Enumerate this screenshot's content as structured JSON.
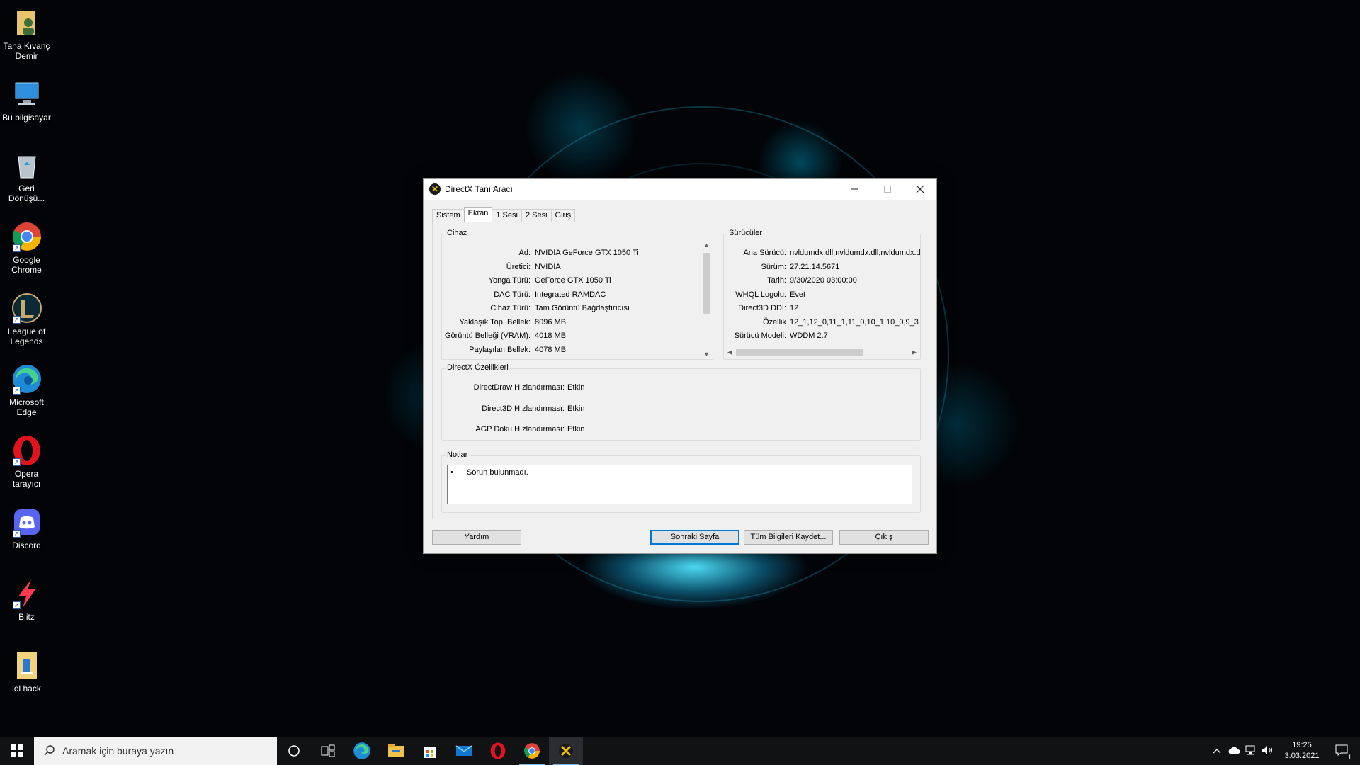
{
  "desktop": {
    "icons": [
      {
        "label": "Taha Kıvanç Demir",
        "icon": "user-folder-icon"
      },
      {
        "label": "Bu bilgisayar",
        "icon": "this-pc-icon"
      },
      {
        "label": "Geri Dönüşü...",
        "icon": "recycle-bin-icon"
      },
      {
        "label": "Google Chrome",
        "icon": "chrome-icon"
      },
      {
        "label": "League of Legends",
        "icon": "league-of-legends-icon"
      },
      {
        "label": "Microsoft Edge",
        "icon": "edge-icon"
      },
      {
        "label": "Opera tarayıcı",
        "icon": "opera-icon"
      },
      {
        "label": "Discord",
        "icon": "discord-icon"
      },
      {
        "label": "Blitz",
        "icon": "blitz-icon"
      },
      {
        "label": "lol hack",
        "icon": "file-icon"
      }
    ]
  },
  "dialog": {
    "title": "DirectX Tanı Aracı",
    "tabs": [
      {
        "label": "Sistem"
      },
      {
        "label": "Ekran",
        "active": true
      },
      {
        "label": "1 Sesi"
      },
      {
        "label": "2 Sesi"
      },
      {
        "label": "Giriş"
      }
    ],
    "device": {
      "label": "Cihaz",
      "rows": [
        {
          "k": "Ad:",
          "v": "NVIDIA GeForce GTX 1050 Ti"
        },
        {
          "k": "Üretici:",
          "v": "NVIDIA"
        },
        {
          "k": "Yonga Türü:",
          "v": "GeForce GTX 1050 Ti"
        },
        {
          "k": "DAC Türü:",
          "v": "Integrated RAMDAC"
        },
        {
          "k": "Cihaz Türü:",
          "v": "Tam Görüntü Bağdaştırıcısı"
        },
        {
          "k": "Yaklaşık Top. Bellek:",
          "v": "8096 MB"
        },
        {
          "k": "Görüntü Belleği (VRAM):",
          "v": "4018 MB"
        },
        {
          "k": "Paylaşılan Bellek:",
          "v": "4078 MB"
        }
      ]
    },
    "drivers": {
      "label": "Sürücüler",
      "rows": [
        {
          "k": "Ana Sürücü:",
          "v": "nvldumdx.dll,nvldumdx.dll,nvldumdx.dll"
        },
        {
          "k": "Sürüm:",
          "v": "27.21.14.5671"
        },
        {
          "k": "Tarih:",
          "v": "9/30/2020 03:00:00"
        },
        {
          "k": "WHQL Logolu:",
          "v": "Evet"
        },
        {
          "k": "Direct3D DDI:",
          "v": "12"
        },
        {
          "k": "Özellik",
          "v": "12_1,12_0,11_1,11_0,10_1,10_0,9_3"
        },
        {
          "k": "Sürücü Modeli:",
          "v": "WDDM 2.7"
        }
      ]
    },
    "directx_features": {
      "label": "DirectX Özellikleri",
      "rows": [
        {
          "k": "DirectDraw Hızlandırması:",
          "v": "Etkin"
        },
        {
          "k": "Direct3D Hızlandırması:",
          "v": "Etkin"
        },
        {
          "k": "AGP Doku Hızlandırması:",
          "v": "Etkin"
        }
      ]
    },
    "notes": {
      "label": "Notlar",
      "items": [
        "Sorun bulunmadı."
      ]
    },
    "buttons": {
      "help": "Yardım",
      "next_page": "Sonraki Sayfa",
      "save_all": "Tüm Bilgileri Kaydet...",
      "exit": "Çıkış"
    }
  },
  "taskbar": {
    "search_placeholder": "Aramak için buraya yazın",
    "apps": [
      "cortana-icon",
      "task-view-icon",
      "edge-icon",
      "file-explorer-icon",
      "store-icon",
      "mail-icon",
      "opera-icon",
      "chrome-icon",
      "dxdiag-icon"
    ],
    "clock_time": "19:25",
    "clock_date": "3.03.2021",
    "notification_count": "1"
  }
}
